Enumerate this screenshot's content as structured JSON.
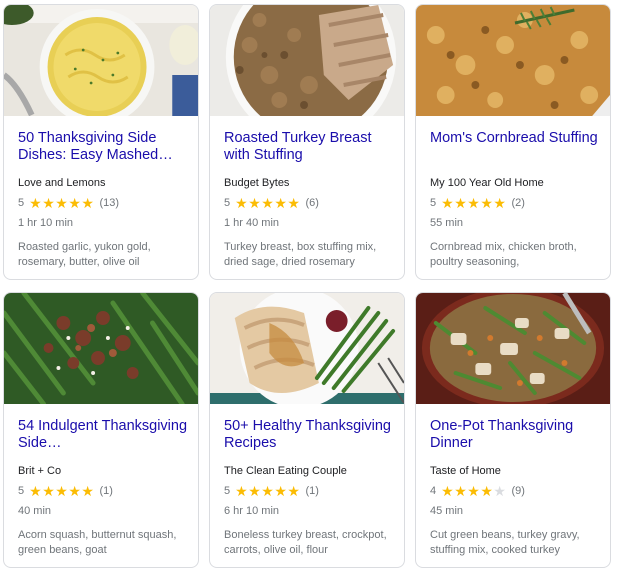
{
  "recipes": [
    {
      "title": "50 Thanksgiving Side Dishes: Easy Mashed…",
      "source": "Love and Lemons",
      "rating": "5",
      "stars": 5,
      "reviews": "(13)",
      "time": "1 hr 10 min",
      "ingredients": "Roasted garlic, yukon gold, rosemary, butter, olive oil",
      "image": "mashed-potatoes-photo"
    },
    {
      "title": "Roasted Turkey Breast with Stuffing",
      "source": "Budget Bytes",
      "rating": "5",
      "stars": 5,
      "reviews": "(6)",
      "time": "1 hr 40 min",
      "ingredients": "Turkey breast, box stuffing mix, dried sage, dried rosemary",
      "image": "turkey-stuffing-photo"
    },
    {
      "title": "Mom's Cornbread Stuffing",
      "source": "My 100 Year Old Home",
      "rating": "5",
      "stars": 5,
      "reviews": "(2)",
      "time": "55 min",
      "ingredients": "Cornbread mix, chicken broth, poultry seasoning,",
      "image": "cornbread-stuffing-photo"
    },
    {
      "title": "54 Indulgent Thanksgiving Side…",
      "source": "Brit + Co",
      "rating": "5",
      "stars": 5,
      "reviews": "(1)",
      "time": "40 min",
      "ingredients": "Acorn squash, butternut squash, green beans, goat",
      "image": "green-beans-bacon-photo"
    },
    {
      "title": "50+ Healthy Thanksgiving Recipes",
      "source": "The Clean Eating Couple",
      "rating": "5",
      "stars": 5,
      "reviews": "(1)",
      "time": "6 hr 10 min",
      "ingredients": "Boneless turkey breast, crockpot, carrots, olive oil, flour",
      "image": "turkey-green-beans-photo"
    },
    {
      "title": "One-Pot Thanksgiving Dinner",
      "source": "Taste of Home",
      "rating": "4",
      "stars": 4,
      "reviews": "(9)",
      "time": "45 min",
      "ingredients": "Cut green beans, turkey gravy, stuffing mix, cooked turkey",
      "image": "one-pot-dinner-photo"
    }
  ],
  "colors": {
    "title_link": "#1a0dab",
    "star_filled": "#fbbc04",
    "star_empty": "#dadce0",
    "meta_text": "#70757a"
  }
}
